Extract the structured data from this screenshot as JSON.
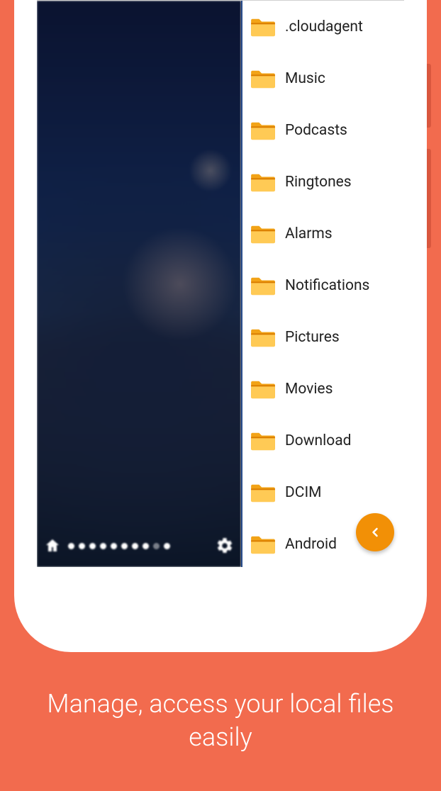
{
  "caption": "Manage, access your local files easily",
  "page_indicator": {
    "total": 10,
    "active_index": 8
  },
  "folders": [
    {
      "name": ".cloudagent"
    },
    {
      "name": "Music"
    },
    {
      "name": "Podcasts"
    },
    {
      "name": "Ringtones"
    },
    {
      "name": "Alarms"
    },
    {
      "name": "Notifications"
    },
    {
      "name": "Pictures"
    },
    {
      "name": "Movies"
    },
    {
      "name": "Download"
    },
    {
      "name": "DCIM"
    },
    {
      "name": "Android"
    }
  ],
  "colors": {
    "background": "#f26b4e",
    "folder": "#f2a317",
    "fab": "#f29006"
  }
}
